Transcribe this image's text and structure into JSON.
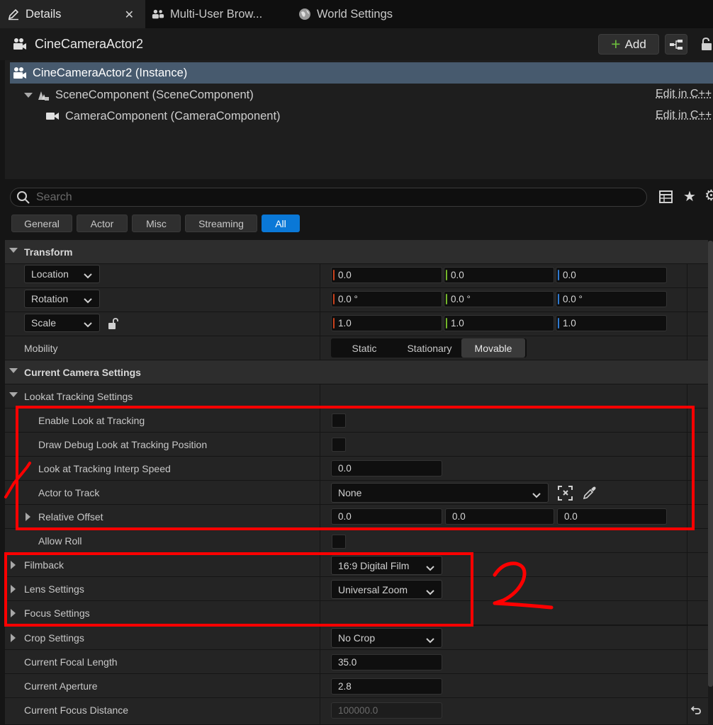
{
  "tabs": [
    {
      "label": "Details",
      "icon": "pencil-icon",
      "active": true
    },
    {
      "label": "Multi-User Brow...",
      "icon": "users-icon",
      "active": false
    },
    {
      "label": "World Settings",
      "icon": "globe-icon",
      "active": false
    }
  ],
  "header": {
    "actor_name": "CineCameraActor2",
    "add_label": "Add"
  },
  "tree": {
    "items": [
      {
        "label": "CineCameraActor2 (Instance)",
        "icon": "camera-actor-icon",
        "selected": true
      },
      {
        "label": "SceneComponent (SceneComponent)",
        "icon": "scene-component-icon",
        "edit": "Edit in C++"
      },
      {
        "label": "CameraComponent (CameraComponent)",
        "icon": "video-camera-icon",
        "edit": "Edit in C++"
      }
    ]
  },
  "search": {
    "placeholder": "Search"
  },
  "filters": [
    "General",
    "Actor",
    "Misc",
    "Streaming",
    "All"
  ],
  "active_filter": "All",
  "transform": {
    "title": "Transform",
    "location_label": "Location",
    "rotation_label": "Rotation",
    "scale_label": "Scale",
    "location": [
      "0.0",
      "0.0",
      "0.0"
    ],
    "rotation": [
      "0.0 °",
      "0.0 °",
      "0.0 °"
    ],
    "scale": [
      "1.0",
      "1.0",
      "1.0"
    ],
    "mobility_label": "Mobility",
    "mobility_options": [
      "Static",
      "Stationary",
      "Movable"
    ],
    "mobility_selected": "Movable"
  },
  "camera": {
    "title": "Current Camera Settings",
    "lookat_title": "Lookat Tracking Settings",
    "enable_lookat": "Enable Look at Tracking",
    "draw_debug": "Draw Debug Look at Tracking Position",
    "interp_speed_label": "Look at Tracking Interp Speed",
    "interp_speed": "0.0",
    "actor_to_track_label": "Actor to Track",
    "actor_to_track": "None",
    "relative_offset_label": "Relative Offset",
    "relative_offset": [
      "0.0",
      "0.0",
      "0.0"
    ],
    "allow_roll": "Allow Roll",
    "filmback_label": "Filmback",
    "filmback": "16:9 Digital Film",
    "lens_label": "Lens Settings",
    "lens": "Universal Zoom",
    "focus_label": "Focus Settings",
    "crop_label": "Crop Settings",
    "crop": "No Crop",
    "focal_length_label": "Current Focal Length",
    "focal_length": "35.0",
    "aperture_label": "Current Aperture",
    "aperture": "2.8",
    "focus_distance_label": "Current Focus Distance",
    "focus_distance": "100000.0"
  },
  "colors": {
    "axis_x": "#c8401c",
    "axis_y": "#74b62a",
    "axis_z": "#2f7ad0",
    "accent": "#0a78d7",
    "annotation": "#ff0000"
  }
}
